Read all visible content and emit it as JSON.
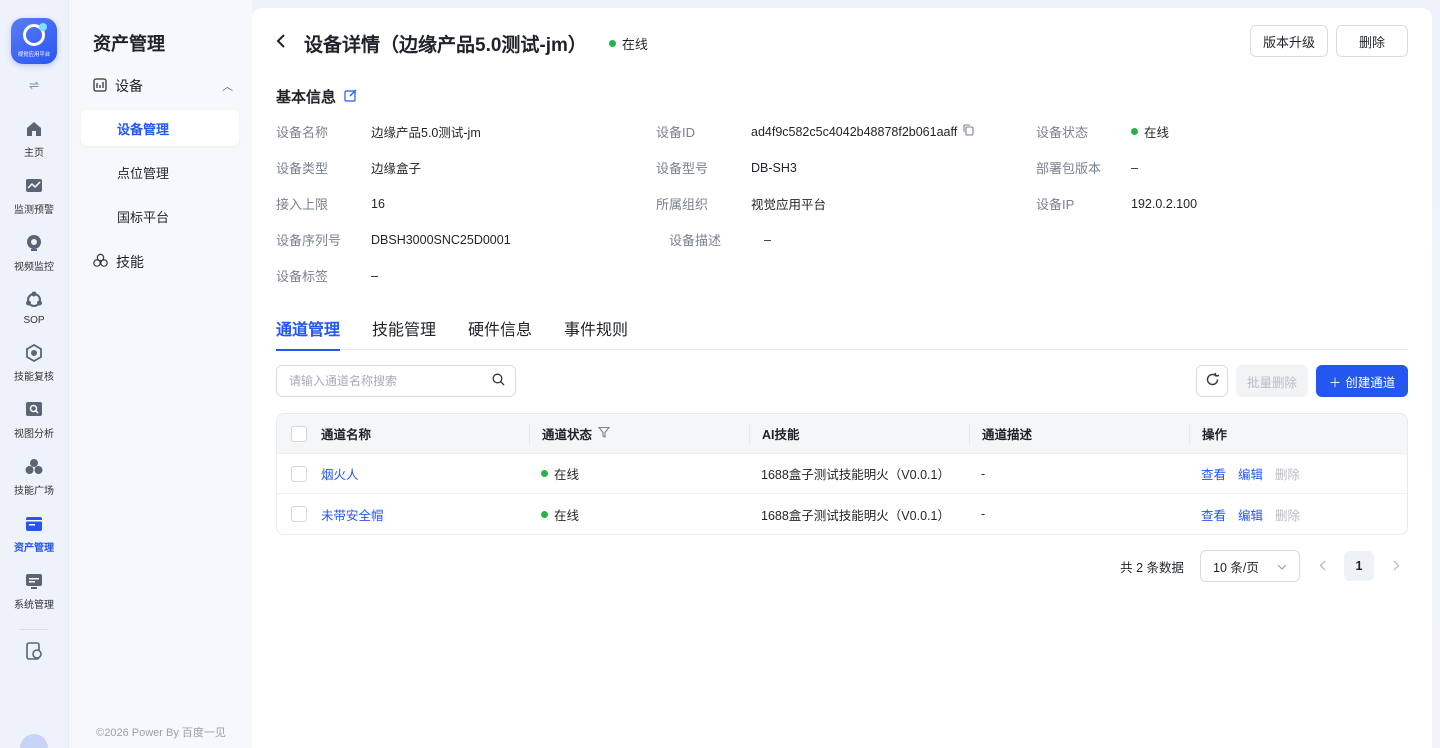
{
  "rail": {
    "logo_text": "视觉应用平台",
    "toggle": "⇌",
    "items": [
      {
        "label": "主页",
        "icon": "home-icon"
      },
      {
        "label": "监测预警",
        "icon": "monitor-chart-icon"
      },
      {
        "label": "视频监控",
        "icon": "camera-icon"
      },
      {
        "label": "SOP",
        "icon": "sop-icon"
      },
      {
        "label": "技能复核",
        "icon": "review-icon"
      },
      {
        "label": "视图分析",
        "icon": "analysis-icon"
      },
      {
        "label": "技能广场",
        "icon": "skills-plaza-icon"
      },
      {
        "label": "资产管理",
        "icon": "asset-icon"
      },
      {
        "label": "系统管理",
        "icon": "system-icon"
      }
    ]
  },
  "sidebar": {
    "title": "资产管理",
    "group_label": "设备",
    "items": [
      "设备管理",
      "点位管理",
      "国标平台"
    ],
    "skill_label": "技能",
    "footer": "©2026 Power By 百度一见"
  },
  "header": {
    "title": "设备详情（边缘产品5.0测试-jm）",
    "status": "在线",
    "upgrade_button": "版本升级",
    "delete_button": "删除"
  },
  "basic_info": {
    "title": "基本信息",
    "rows": [
      [
        {
          "label": "设备名称",
          "value": "边缘产品5.0测试-jm"
        },
        {
          "label": "设备ID",
          "value": "ad4f9c582c5c4042b48878f2b061aaff"
        },
        {
          "label": "设备状态",
          "value": "在线"
        }
      ],
      [
        {
          "label": "设备类型",
          "value": "边缘盒子"
        },
        {
          "label": "设备型号",
          "value": "DB-SH3"
        },
        {
          "label": "部署包版本",
          "value": "–"
        }
      ],
      [
        {
          "label": "接入上限",
          "value": "16"
        },
        {
          "label": "所属组织",
          "value": "视觉应用平台"
        },
        {
          "label": "设备IP",
          "value": "192.0.2.100"
        }
      ],
      [
        {
          "label": "设备序列号",
          "value": "DBSH3000SNC25D0001"
        },
        {
          "label": "设备描述",
          "value": "–"
        }
      ],
      [
        {
          "label": "设备标签",
          "value": "–"
        }
      ]
    ]
  },
  "tabs": [
    "通道管理",
    "技能管理",
    "硬件信息",
    "事件规则"
  ],
  "toolbar": {
    "search_placeholder": "请输入通道名称搜索",
    "batch_delete": "批量删除",
    "create": "创建通道"
  },
  "table": {
    "columns": [
      "通道名称",
      "通道状态",
      "AI技能",
      "通道描述",
      "操作"
    ],
    "rows": [
      {
        "name": "烟火人",
        "status": "在线",
        "skill": "1688盒子测试技能明火（V0.0.1）",
        "desc": "-",
        "view": "查看",
        "edit": "编辑",
        "delete": "删除"
      },
      {
        "name": "未带安全帽",
        "status": "在线",
        "skill": "1688盒子测试技能明火（V0.0.1）",
        "desc": "-",
        "view": "查看",
        "edit": "编辑",
        "delete": "删除"
      }
    ]
  },
  "pager": {
    "total": "共 2 条数据",
    "page_size": "10 条/页",
    "current": "1"
  },
  "colors": {
    "primary": "#2456f0",
    "online": "#24b34b"
  }
}
